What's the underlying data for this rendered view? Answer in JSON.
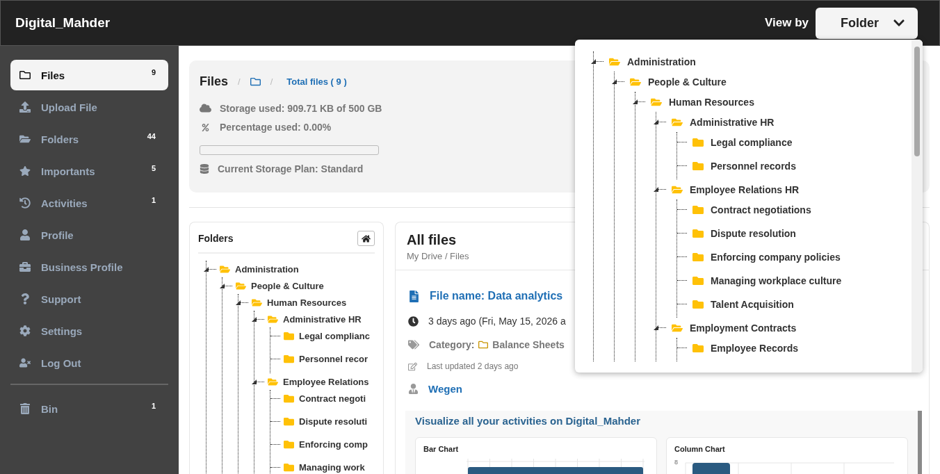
{
  "header": {
    "brand": "Digital_Mahder",
    "view_by_label": "View by",
    "view_by_value": "Folder"
  },
  "sidebar": {
    "items": [
      {
        "label": "Files",
        "count": "9",
        "selected": true
      },
      {
        "label": "Upload File",
        "selected": false
      },
      {
        "label": "Folders",
        "count": "44",
        "selected": false
      },
      {
        "label": "Importants",
        "count": "5",
        "selected": false
      },
      {
        "label": "Activities",
        "count": "1",
        "selected": false
      },
      {
        "label": "Profile",
        "selected": false
      },
      {
        "label": "Business Profile",
        "selected": false
      },
      {
        "label": "Support",
        "selected": false
      },
      {
        "label": "Settings",
        "selected": false
      },
      {
        "label": "Log Out",
        "selected": false
      }
    ],
    "bottom_items": [
      {
        "label": "Bin",
        "count": "1",
        "selected": false
      }
    ]
  },
  "storage": {
    "title": "Files",
    "separator": "/",
    "total_files": "Total files ( 9 )",
    "storage_used": "Storage used: 909.71 KB of 500 GB",
    "percentage_used": "Percentage used: 0.00%",
    "level": 0,
    "plan": "Current Storage Plan: Standard"
  },
  "folders_panel": {
    "title": "Folders",
    "tree": [
      {
        "label": "Administration",
        "expanded": true,
        "children": [
          {
            "label": "People & Culture",
            "expanded": true,
            "children": [
              {
                "label": "Human Resources",
                "expanded": true,
                "children": [
                  {
                    "label": "Administrative HR",
                    "expanded": true,
                    "children": [
                      {
                        "label": "Legal complianc",
                        "expanded": false
                      },
                      {
                        "label": "Personnel recor",
                        "expanded": false
                      }
                    ]
                  },
                  {
                    "label": "Employee Relations",
                    "expanded": true,
                    "children": [
                      {
                        "label": "Contract negoti",
                        "expanded": false
                      },
                      {
                        "label": "Dispute resoluti",
                        "expanded": false
                      },
                      {
                        "label": "Enforcing comp",
                        "expanded": false
                      },
                      {
                        "label": "Managing work",
                        "expanded": false
                      }
                    ]
                  }
                ]
              }
            ]
          }
        ]
      }
    ]
  },
  "all_files": {
    "title": "All files",
    "breadcrumb": "My Drive / Files",
    "file_name": "File name: Data analytics",
    "date": "3 days ago (Fri, May 15, 2026 a",
    "category_label": "Category:",
    "category": "Balance Sheets",
    "last_updated": "Last updated 2 days ago",
    "owner": "Wegen",
    "visualize": {
      "title": "Visualize all your activities on Digital_Mahder",
      "charts": [
        {
          "kind": "bar",
          "title": "Bar Chart"
        },
        {
          "kind": "column",
          "title": "Column Chart",
          "tick": "8"
        }
      ]
    }
  },
  "view_by_menu": {
    "tree": [
      {
        "label": "Administration",
        "expanded": true,
        "children": [
          {
            "label": "People & Culture",
            "expanded": true,
            "children": [
              {
                "label": "Human Resources",
                "expanded": true,
                "children": [
                  {
                    "label": "Administrative HR",
                    "expanded": true,
                    "children": [
                      {
                        "label": "Legal compliance",
                        "expanded": false
                      },
                      {
                        "label": "Personnel records",
                        "expanded": false
                      }
                    ]
                  },
                  {
                    "label": "Employee Relations HR",
                    "expanded": true,
                    "children": [
                      {
                        "label": "Contract negotiations",
                        "expanded": false
                      },
                      {
                        "label": "Dispute resolution",
                        "expanded": false
                      },
                      {
                        "label": "Enforcing company policies",
                        "expanded": false
                      },
                      {
                        "label": "Managing workplace culture",
                        "expanded": false
                      },
                      {
                        "label": "Talent Acquisition",
                        "expanded": false
                      }
                    ]
                  },
                  {
                    "label": "Employment Contracts",
                    "expanded": true,
                    "children": [
                      {
                        "label": "Employee Records",
                        "expanded": false
                      }
                    ]
                  }
                ]
              }
            ]
          }
        ]
      }
    ]
  }
}
